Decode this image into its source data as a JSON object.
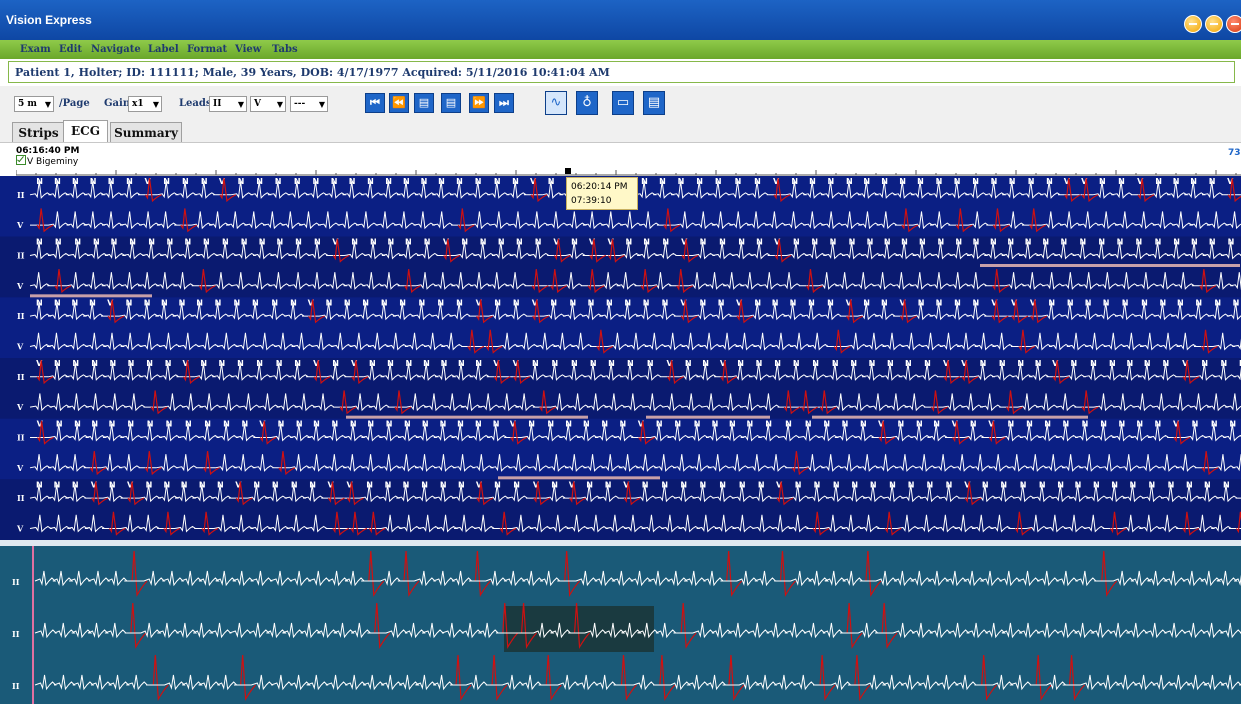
{
  "window": {
    "title": "Vision Express"
  },
  "menu": [
    "Exam",
    "Edit",
    "Navigate",
    "Label",
    "Format",
    "View",
    "Tabs"
  ],
  "patient": {
    "info": "Patient 1, Holter; ID: 111111; Male, 39 Years, DOB: 4/17/1977 Acquired: 5/11/2016 10:41:04 AM"
  },
  "toolbar": {
    "page_value": "5 m",
    "page_label": "/Page",
    "gain_label": "Gain",
    "gain_value": "x1",
    "leads_label": "Leads",
    "lead1_value": "II",
    "lead2_value": "V",
    "lead3_value": "---",
    "nav_buttons": [
      "first-page",
      "previous-page",
      "page-back",
      "page-forward",
      "next-page",
      "last-page"
    ],
    "view_buttons": [
      "ecg-view",
      "pacer-view",
      "strip-view",
      "report-view"
    ]
  },
  "tabs": [
    "Strips",
    "ECG",
    "Summary"
  ],
  "active_tab": "ECG",
  "ecg": {
    "start_time": "06:16:40 PM",
    "event_label": "V Bigeminy",
    "event_checked": true,
    "page_number": "73",
    "tooltip_time": "06:20:14 PM",
    "tooltip_elapsed": "07:39:10",
    "row_leads": [
      "II",
      "V",
      "II",
      "V",
      "II",
      "V",
      "II",
      "V",
      "II",
      "V",
      "II",
      "V"
    ],
    "beat_labels": {
      "normal": "N",
      "ventricular": "V"
    },
    "strip_leads": [
      "II",
      "II",
      "II"
    ]
  },
  "colors": {
    "titlebar": "#1553b5",
    "menubar": "#7cb83c",
    "ecg_background": "#0a1a6e",
    "ecg_trace": "#ffffff",
    "ventricular_trace": "#d01010",
    "event_bar": "#c8a0a8",
    "strip_background": "#1a5a78"
  }
}
